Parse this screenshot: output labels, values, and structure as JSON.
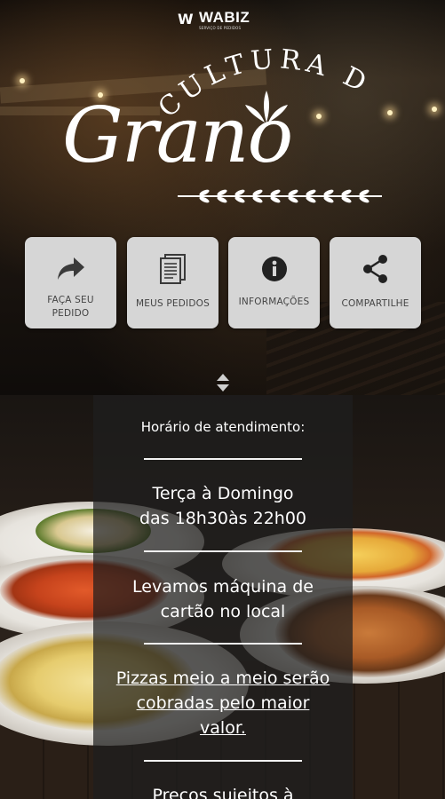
{
  "logo": {
    "mark": "W",
    "name": "WABIZ",
    "sub": "SERVIÇO DE PEDIDOS"
  },
  "brand": {
    "top": "CULTURA DEL",
    "main": "Grano"
  },
  "actions": [
    {
      "label_line1": "FAÇA SEU",
      "label_line2": "PEDIDO",
      "icon": "share-arrow-icon"
    },
    {
      "label_line1": "MEUS PEDIDOS",
      "label_line2": "",
      "icon": "document-list-icon"
    },
    {
      "label_line1": "INFORMAÇÕES",
      "label_line2": "",
      "icon": "info-icon"
    },
    {
      "label_line1": "COMPARTILHE",
      "label_line2": "",
      "icon": "share-icon"
    }
  ],
  "info": {
    "heading": "Horário de atendimento:",
    "hours_line1": "Terça  à Domingo",
    "hours_line2": "das 18h30às 22h00",
    "card_line1": "Levamos máquina de",
    "card_line2": "cartão no local",
    "pizza_line1": "Pizzas meio a meio serão",
    "pizza_line2": "cobradas pelo maior",
    "pizza_line3": "valor.",
    "prices_line1": "Preços sujeitos à"
  },
  "colors": {
    "tile": "#d6d6d6",
    "tile_text": "#444444",
    "panel": "#1e1e1e"
  }
}
